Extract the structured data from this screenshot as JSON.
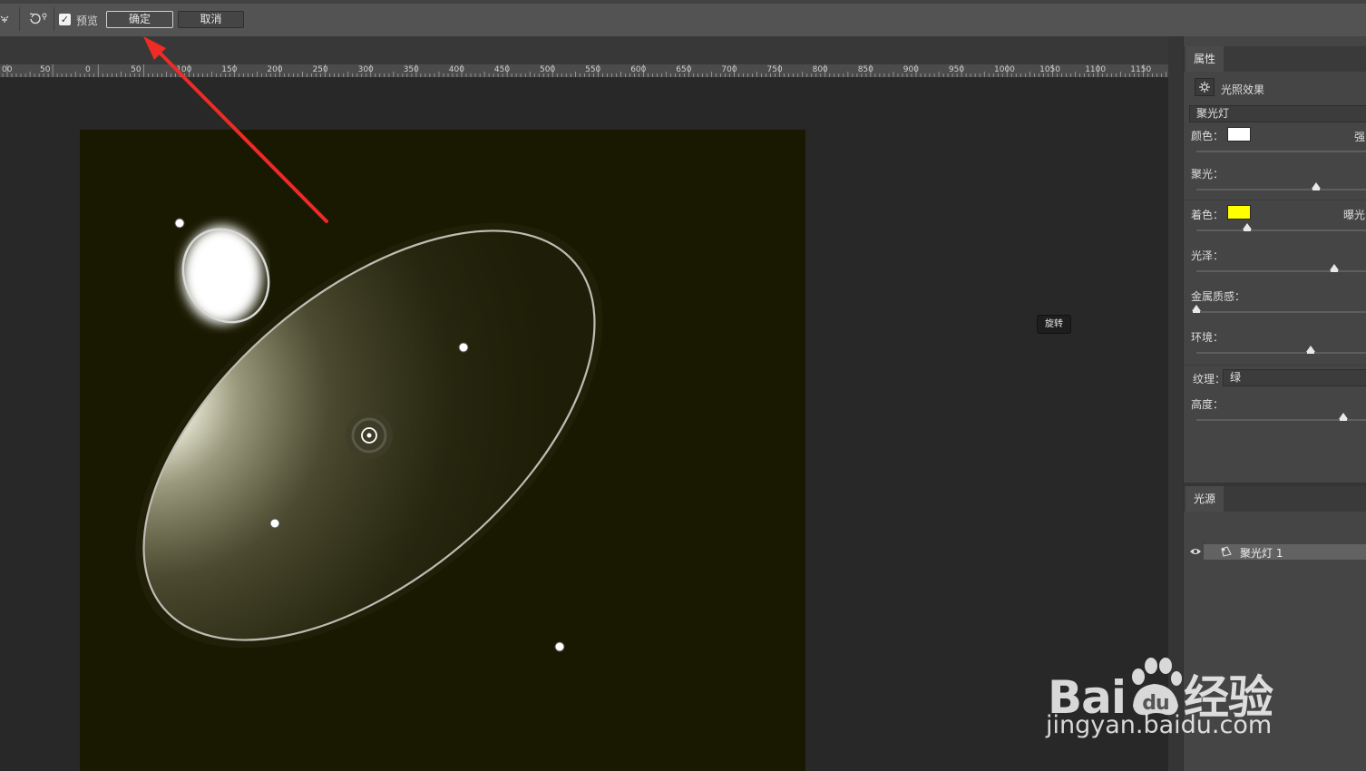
{
  "toolbar": {
    "preview_label": "预览",
    "preview_checked": true,
    "ok_label": "确定",
    "cancel_label": "取消"
  },
  "ruler": {
    "labels": [
      "00",
      "50",
      "0",
      "50",
      "100",
      "150",
      "200",
      "250",
      "300",
      "350",
      "400",
      "450",
      "500",
      "550",
      "600",
      "650",
      "700",
      "750",
      "800",
      "850",
      "900",
      "950",
      "1000",
      "1050",
      "1100",
      "1150"
    ]
  },
  "canvas": {
    "tooltip": "旋转",
    "background_color": "#191901",
    "light_color": "#ffffff"
  },
  "properties": {
    "tab_label": "属性",
    "effect_title": "光照效果",
    "light_type": "聚光灯",
    "color_label": "颜色：",
    "intensity_label": "强",
    "light_color": "#ffffff",
    "hotspot_label": "聚光：",
    "hotspot_value": 0.7,
    "colorize_label": "着色：",
    "colorize_color": "#ffff00",
    "exposure_label": "曝光",
    "colorize_value": 0.3,
    "gloss_label": "光泽：",
    "gloss_value": 0.81,
    "metallic_label": "金属质感：",
    "metallic_value": 0.0,
    "ambience_label": "环境：",
    "ambience_value": 0.67,
    "texture_label": "纹理：",
    "texture_value": "绿",
    "height_label": "高度：",
    "height_value": 0.86
  },
  "lights": {
    "tab_label": "光源",
    "items": [
      {
        "name": "聚光灯 1"
      }
    ]
  },
  "watermark": {
    "logo_text": "Bai du 经验",
    "url": "jingyan.baidu.com"
  },
  "colors": {
    "annotation_arrow": "#ee2b24",
    "panel_bg": "#454545",
    "workspace_bg": "#282828"
  }
}
